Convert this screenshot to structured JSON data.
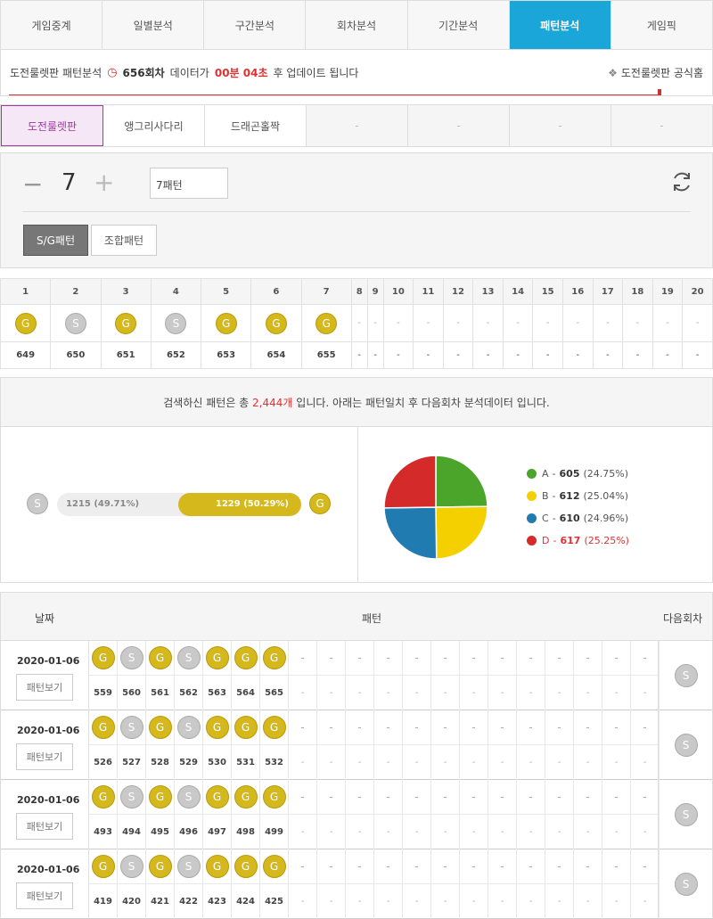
{
  "topnav": [
    "게임중계",
    "일별분석",
    "구간분석",
    "회차분석",
    "기간분석",
    "패턴분석",
    "게임픽"
  ],
  "topnav_active": 5,
  "info": {
    "prefix": "도전룰렛판 패턴분석",
    "round": "656회차",
    "mid": "데이터가",
    "time": "00분 04초",
    "suffix": "후 업데이트 됩니다",
    "official": "도전룰렛판 공식홈"
  },
  "gametabs": [
    "도전룰렛판",
    "앵그리사다리",
    "드래곤홀짝",
    "-",
    "-",
    "-",
    "-"
  ],
  "control": {
    "minus": "−",
    "value": "7",
    "plus": "+",
    "pattern_box": "7패턴",
    "sg_button": "S/G패턴",
    "combo_button": "조합패턴"
  },
  "pattern_table": {
    "headers": [
      "1",
      "2",
      "3",
      "4",
      "5",
      "6",
      "7",
      "8",
      "9",
      "10",
      "11",
      "12",
      "13",
      "14",
      "15",
      "16",
      "17",
      "18",
      "19",
      "20"
    ],
    "balls": [
      "G",
      "S",
      "G",
      "S",
      "G",
      "G",
      "G"
    ],
    "rounds": [
      "649",
      "650",
      "651",
      "652",
      "653",
      "654",
      "655"
    ],
    "dash": "-"
  },
  "summary": {
    "pre": "검색하신 패턴은 총",
    "count": "2,444개",
    "post": "입니다. 아래는 패턴일치 후 다음회차 분석데이터 입니다."
  },
  "sg_bar": {
    "s_label": "S",
    "g_label": "G",
    "s_text": "1215 (49.71%)",
    "g_text": "1229 (50.29%)",
    "g_percent": 50.29
  },
  "pie": {
    "colors": {
      "A": "#4aa52a",
      "B": "#f5d000",
      "C": "#1f7bb0",
      "D": "#d42a2a"
    },
    "items": [
      {
        "key": "A",
        "value": "605",
        "pct": "(24.75%)",
        "num": 605
      },
      {
        "key": "B",
        "value": "612",
        "pct": "(25.04%)",
        "num": 612
      },
      {
        "key": "C",
        "value": "610",
        "pct": "(24.96%)",
        "num": 610
      },
      {
        "key": "D",
        "value": "617",
        "pct": "(25.25%)",
        "num": 617
      }
    ],
    "sep": "-"
  },
  "history": {
    "headers": {
      "date": "날짜",
      "pattern": "패턴",
      "next": "다음회차"
    },
    "view_label": "패턴보기",
    "rows": [
      {
        "date": "2020-01-06",
        "balls": [
          "G",
          "S",
          "G",
          "S",
          "G",
          "G",
          "G"
        ],
        "rounds": [
          "559",
          "560",
          "561",
          "562",
          "563",
          "564",
          "565"
        ],
        "next": "S"
      },
      {
        "date": "2020-01-06",
        "balls": [
          "G",
          "S",
          "G",
          "S",
          "G",
          "G",
          "G"
        ],
        "rounds": [
          "526",
          "527",
          "528",
          "529",
          "530",
          "531",
          "532"
        ],
        "next": "S"
      },
      {
        "date": "2020-01-06",
        "balls": [
          "G",
          "S",
          "G",
          "S",
          "G",
          "G",
          "G"
        ],
        "rounds": [
          "493",
          "494",
          "495",
          "496",
          "497",
          "498",
          "499"
        ],
        "next": "S"
      },
      {
        "date": "2020-01-06",
        "balls": [
          "G",
          "S",
          "G",
          "S",
          "G",
          "G",
          "G"
        ],
        "rounds": [
          "419",
          "420",
          "421",
          "422",
          "423",
          "424",
          "425"
        ],
        "next": "S"
      }
    ]
  }
}
